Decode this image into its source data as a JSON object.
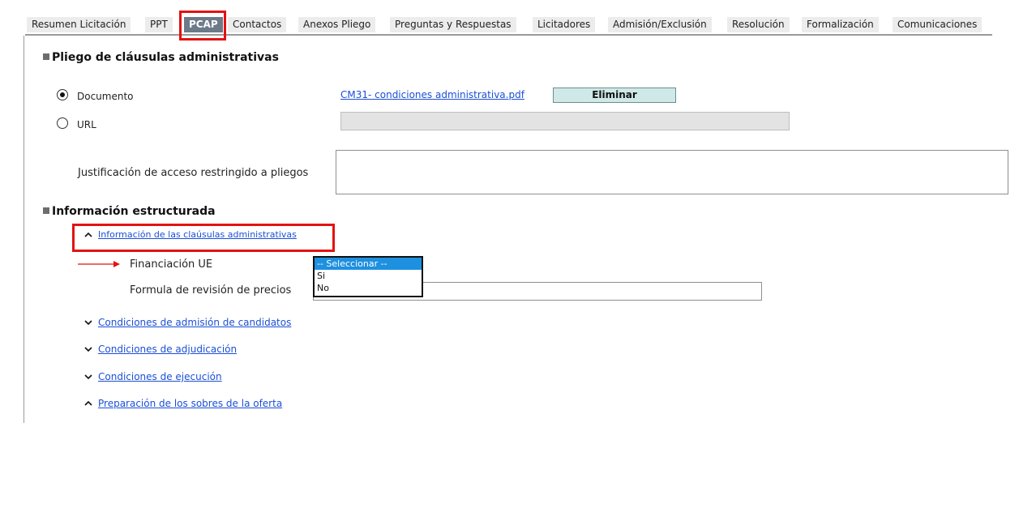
{
  "tabs": [
    {
      "label": "Resumen Licitación"
    },
    {
      "label": "PPT"
    },
    {
      "label": "PCAP"
    },
    {
      "label": "Contactos"
    },
    {
      "label": "Anexos Pliego"
    },
    {
      "label": "Preguntas y Respuestas"
    },
    {
      "label": "Licitadores"
    },
    {
      "label": "Admisión/Exclusión"
    },
    {
      "label": "Resolución"
    },
    {
      "label": "Formalización"
    },
    {
      "label": "Comunicaciones"
    }
  ],
  "active_tab": "PCAP",
  "pliego": {
    "title": "Pliego de cláusulas administrativas",
    "documento_label": "Documento",
    "url_label": "URL",
    "file_link": "CM31- condiciones administrativa.pdf",
    "eliminar_label": "Eliminar",
    "url_value": "",
    "justificacion_label": "Justificación de acceso restringido a pliegos",
    "justificacion_value": ""
  },
  "info": {
    "title": "Información estructurada",
    "clausulas_link": "Información de las claúsulas administrativas",
    "financiacion_label": "Financiación UE",
    "formula_label": "Formula de revisión de precios",
    "formula_value": "",
    "dropdown_options": [
      "-- Seleccionar --",
      "Si",
      "No"
    ],
    "selected_option": "-- Seleccionar --",
    "links": [
      "Condiciones de admisión de candidatos",
      "Condiciones de adjudicación",
      "Condiciones de ejecución",
      "Preparación de los sobres de la oferta"
    ]
  },
  "colors": {
    "highlight": "#e31212",
    "link": "#1a4fd6",
    "active_tab": "#6c7a8a",
    "dropdown_selected": "#1e90e0",
    "button_bg": "#cfe9e8"
  }
}
